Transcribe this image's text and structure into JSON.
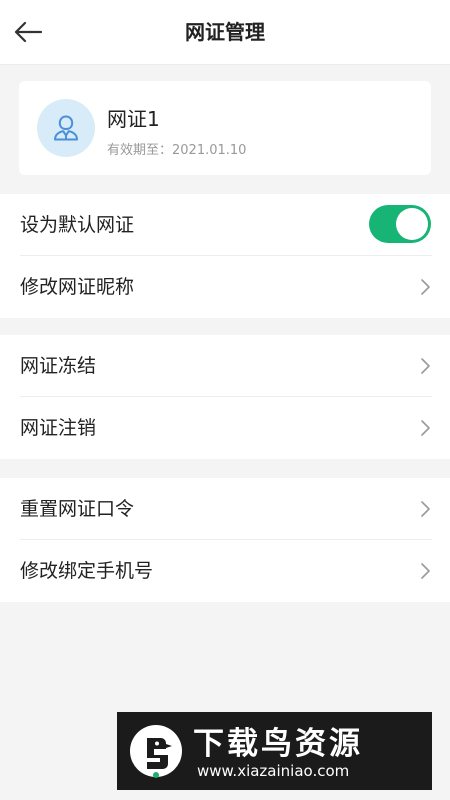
{
  "header": {
    "title": "网证管理",
    "back_icon": "arrow-left-icon"
  },
  "cert": {
    "name": "网证1",
    "valid_until": "有效期至：2021.01.10",
    "avatar_icon": "user-icon",
    "avatar_color": "#d8ebf8",
    "icon_color": "#4a90d9"
  },
  "settings": {
    "default_label": "设为默认网证",
    "default_enabled": true,
    "toggle_color": "#17b575",
    "rename_label": "修改网证昵称",
    "freeze_label": "网证冻结",
    "cancel_label": "网证注销",
    "reset_password_label": "重置网证口令",
    "change_phone_label": "修改绑定手机号"
  },
  "watermark": {
    "title": "下载鸟资源",
    "url": "www.xiazainiao.com"
  }
}
